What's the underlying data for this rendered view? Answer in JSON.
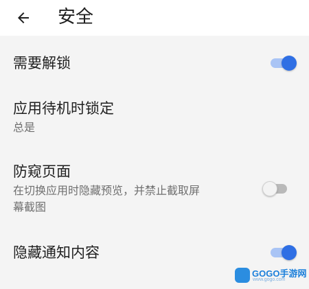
{
  "header": {
    "title": "安全",
    "back_icon": "arrow-back-icon"
  },
  "settings": [
    {
      "title": "需要解锁",
      "subtitle": "",
      "toggle": true
    },
    {
      "title": "应用待机时锁定",
      "subtitle": "总是"
    },
    {
      "title": "防窥页面",
      "subtitle_line1": "在切换应用时隐藏预览，并禁止截取屏",
      "subtitle_line2": "幕截图",
      "toggle": false
    },
    {
      "title": "隐藏通知内容",
      "subtitle": "",
      "toggle": true
    }
  ],
  "watermark": {
    "brand": "GOGO手游网",
    "url": "www.gogo.com"
  },
  "colors": {
    "accent": "#2f6fe4",
    "accent_track": "#a9c4f5",
    "background": "#f4f4f4"
  }
}
